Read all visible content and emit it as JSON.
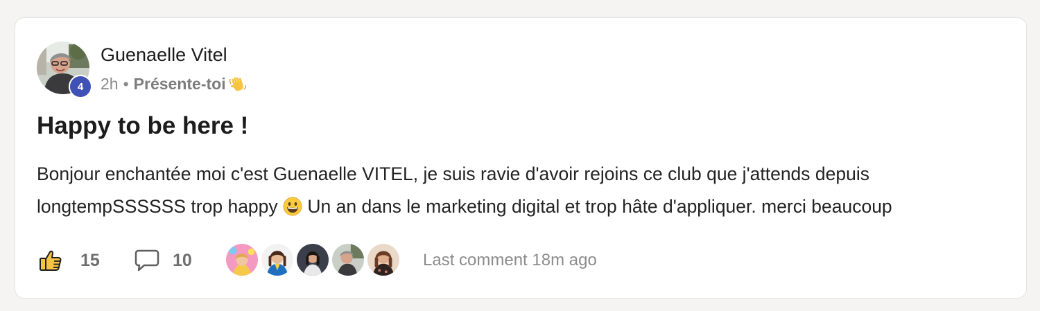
{
  "post": {
    "author": {
      "name": "Guenaelle Vitel",
      "level": "4",
      "avatar_icon": "user-avatar-photo"
    },
    "meta": {
      "time": "2h",
      "separator": "•",
      "space": "Présente-toi",
      "space_emoji_icon": "waving-hand-icon"
    },
    "title": "Happy to be here !",
    "body": {
      "line1": "Bonjour enchantée moi c'est Guenaelle VITEL, je suis ravie d'avoir rejoins ce club que j'attends depuis",
      "line2_before": "longtempSSSSSS trop happy ",
      "emoji_icon": "grinning-face-icon",
      "line2_after": " Un an dans le marketing digital et trop hâte d'appliquer. merci beaucoup"
    },
    "footer": {
      "like_icon": "thumbs-up-icon",
      "like_count": "15",
      "comment_icon": "comment-bubble-icon",
      "comment_count": "10",
      "commenter_avatars": [
        "commenter-avatar-1",
        "commenter-avatar-2",
        "commenter-avatar-3",
        "commenter-avatar-4",
        "commenter-avatar-5"
      ],
      "last_comment": "Last comment 18m ago"
    }
  },
  "colors": {
    "page_background": "#f5f4f2",
    "card_background": "#ffffff",
    "level_badge": "#3f51b5",
    "text_primary": "#1c1c1c",
    "text_muted": "#8a8a8a"
  }
}
